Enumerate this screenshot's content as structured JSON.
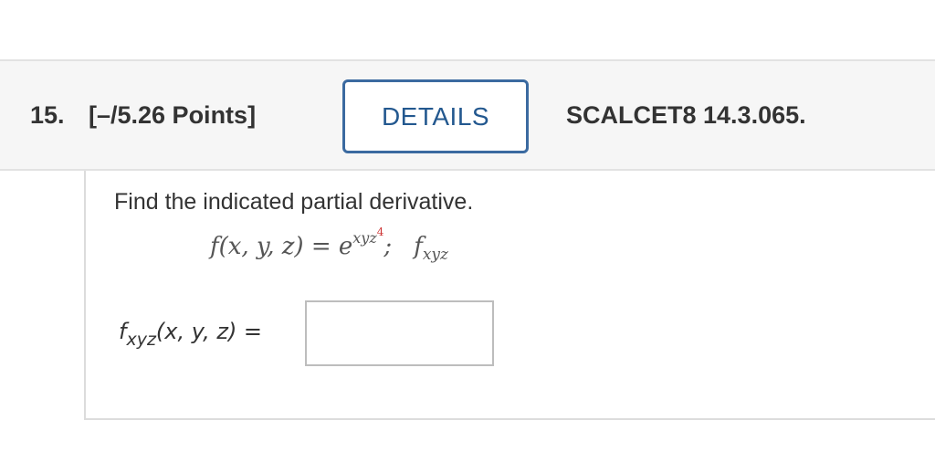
{
  "header": {
    "question_number": "15.",
    "points": "[–/5.26 Points]",
    "details_button": "DETAILS",
    "source": "SCALCET8 14.3.065."
  },
  "question": {
    "prompt": "Find the indicated partial derivative.",
    "function_lhs": "f(x, y, z) = e",
    "exponent_base": "xyz",
    "exponent_power": "4",
    "separator": ";",
    "target_symbol": "f",
    "target_subscript": "xyz",
    "answer_label_f": "f",
    "answer_label_sub": "xyz",
    "answer_label_rest": "(x, y, z) =",
    "answer_value": ""
  }
}
